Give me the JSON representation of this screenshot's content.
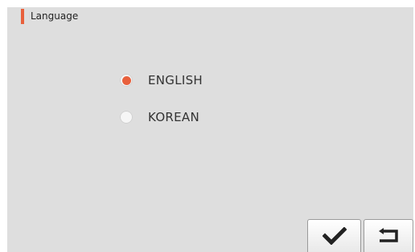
{
  "header": {
    "title": "Language",
    "accent_color": "#e8603c"
  },
  "options": [
    {
      "label": "ENGLISH",
      "selected": true
    },
    {
      "label": "KOREAN",
      "selected": false
    }
  ],
  "buttons": {
    "confirm": {
      "icon": "checkmark-icon"
    },
    "back": {
      "icon": "return-arrow-icon"
    }
  }
}
